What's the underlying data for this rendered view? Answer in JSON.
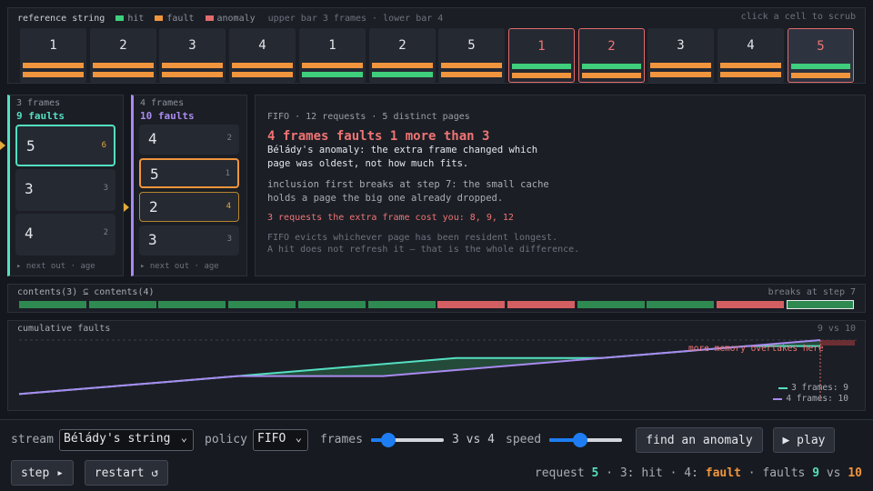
{
  "colors": {
    "hit": "#3fcf7c",
    "fault": "#f0953d",
    "anomaly": "#e26b6b",
    "three": "#54dfc1",
    "four": "#a98af0",
    "ptr": "#e3a93a"
  },
  "reference": {
    "title": "reference string",
    "legend": [
      {
        "label": "hit",
        "color": "#3fcf7c"
      },
      {
        "label": "fault",
        "color": "#f0953d"
      },
      {
        "label": "anomaly",
        "color": "#e26b6b"
      }
    ],
    "note": "upper bar 3 frames · lower bar 4",
    "hint": "click a cell to scrub",
    "cells": [
      {
        "page": "1",
        "upper": "fault",
        "lower": "fault",
        "anomaly": false,
        "current": false
      },
      {
        "page": "2",
        "upper": "fault",
        "lower": "fault",
        "anomaly": false,
        "current": false
      },
      {
        "page": "3",
        "upper": "fault",
        "lower": "fault",
        "anomaly": false,
        "current": false
      },
      {
        "page": "4",
        "upper": "fault",
        "lower": "fault",
        "anomaly": false,
        "current": false
      },
      {
        "page": "1",
        "upper": "fault",
        "lower": "hit",
        "anomaly": false,
        "current": false
      },
      {
        "page": "2",
        "upper": "fault",
        "lower": "hit",
        "anomaly": false,
        "current": false
      },
      {
        "page": "5",
        "upper": "fault",
        "lower": "fault",
        "anomaly": false,
        "current": false
      },
      {
        "page": "1",
        "upper": "hit",
        "lower": "fault",
        "anomaly": true,
        "current": false
      },
      {
        "page": "2",
        "upper": "hit",
        "lower": "fault",
        "anomaly": true,
        "current": false
      },
      {
        "page": "3",
        "upper": "fault",
        "lower": "fault",
        "anomaly": false,
        "current": false
      },
      {
        "page": "4",
        "upper": "fault",
        "lower": "fault",
        "anomaly": false,
        "current": false
      },
      {
        "page": "5",
        "upper": "hit",
        "lower": "fault",
        "anomaly": true,
        "current": true
      }
    ]
  },
  "frames3": {
    "title": "3 frames",
    "faults": "9 faults",
    "slots": [
      {
        "page": "5",
        "age": "6",
        "next": true
      },
      {
        "page": "3",
        "age": "3",
        "next": false
      },
      {
        "page": "4",
        "age": "2",
        "next": false
      }
    ],
    "footer": "▸ next out · age"
  },
  "frames4": {
    "title": "4 frames",
    "faults": "10 faults",
    "slots": [
      {
        "page": "4",
        "age": "2",
        "next": false
      },
      {
        "page": "5",
        "age": "1",
        "next": false
      },
      {
        "page": "2",
        "age": "4",
        "next": true
      },
      {
        "page": "3",
        "age": "3",
        "next": false
      }
    ],
    "footer": "▸ next out · age"
  },
  "explain": {
    "meta": "FIFO · 12 requests · 5 distinct pages",
    "title": "4 frames faults 1 more than 3",
    "body": "Bélády's anomaly: the extra frame changed which page was oldest, not how much fits.",
    "inclusion": "inclusion first breaks at step 7: the small cache holds a page the big one already dropped.",
    "cost": "3 requests the extra frame cost you: 8, 9, 12",
    "foot1": "FIFO evicts whichever page has been resident longest.",
    "foot2": "A hit does not refresh it — that is the whole difference."
  },
  "inclusion": {
    "label": "contents(3) ⊆ contents(4)",
    "right": "breaks at step 7",
    "steps": [
      true,
      true,
      true,
      true,
      true,
      true,
      false,
      false,
      true,
      true,
      false,
      false
    ]
  },
  "cumulative": {
    "title": "cumulative faults",
    "score": "9 vs 10",
    "annotation": "more memory overtakes here",
    "legend3": "3 frames: 9",
    "legend4": "4 frames: 10"
  },
  "chart_data": {
    "type": "line",
    "title": "cumulative faults",
    "x": [
      1,
      2,
      3,
      4,
      5,
      6,
      7,
      8,
      9,
      10,
      11,
      12
    ],
    "series": [
      {
        "name": "3 frames",
        "values": [
          1,
          2,
          3,
          4,
          5,
          6,
          7,
          7,
          7,
          8,
          9,
          9
        ]
      },
      {
        "name": "4 frames",
        "values": [
          1,
          2,
          3,
          4,
          4,
          4,
          5,
          6,
          7,
          8,
          9,
          10
        ]
      }
    ],
    "annotation": "more memory overtakes here",
    "ylim": [
      0,
      10
    ],
    "legend": "bottom-right"
  },
  "controls": {
    "stream_label": "stream",
    "stream_value": "Bélády's string",
    "policy_label": "policy",
    "policy_value": "FIFO",
    "frames_label": "frames",
    "frames_value": "3 vs 4",
    "frames_level": 0.17,
    "speed_label": "speed",
    "speed_level": 0.4,
    "find_button": "find an anomaly",
    "play_button": "▶ play",
    "step_button": "step ▸",
    "restart_button": "restart ↺"
  },
  "status": {
    "prefix": "request",
    "page": "5",
    "three": "3: hit",
    "four_prefix": "4:",
    "four_result": "fault",
    "faults_prefix": "faults",
    "f3": "9",
    "vs": "vs",
    "f4": "10"
  }
}
